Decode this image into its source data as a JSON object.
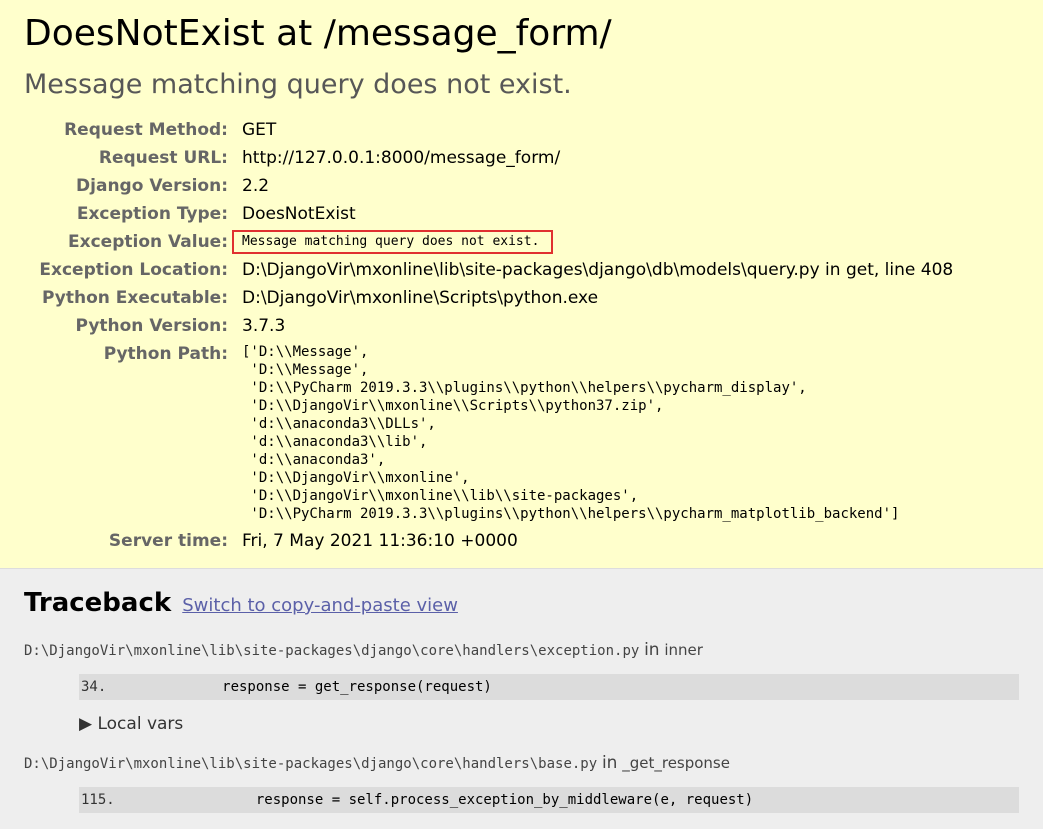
{
  "summary": {
    "title": "DoesNotExist at /message_form/",
    "exception_message": "Message matching query does not exist.",
    "meta": [
      {
        "label": "Request Method:",
        "value": "GET"
      },
      {
        "label": "Request URL:",
        "value": "http://127.0.0.1:8000/message_form/"
      },
      {
        "label": "Django Version:",
        "value": "2.2"
      },
      {
        "label": "Exception Type:",
        "value": "DoesNotExist"
      },
      {
        "label": "Exception Value:",
        "value": "Message matching query does not exist."
      },
      {
        "label": "Exception Location:",
        "value": "D:\\DjangoVir\\mxonline\\lib\\site-packages\\django\\db\\models\\query.py in get, line 408"
      },
      {
        "label": "Python Executable:",
        "value": "D:\\DjangoVir\\mxonline\\Scripts\\python.exe"
      },
      {
        "label": "Python Version:",
        "value": "3.7.3"
      },
      {
        "label": "Python Path:",
        "value": "['D:\\\\Message',\n 'D:\\\\Message',\n 'D:\\\\PyCharm 2019.3.3\\\\plugins\\\\python\\\\helpers\\\\pycharm_display',\n 'D:\\\\DjangoVir\\\\mxonline\\\\Scripts\\\\python37.zip',\n 'd:\\\\anaconda3\\\\DLLs',\n 'd:\\\\anaconda3\\\\lib',\n 'd:\\\\anaconda3',\n 'D:\\\\DjangoVir\\\\mxonline',\n 'D:\\\\DjangoVir\\\\mxonline\\\\lib\\\\site-packages',\n 'D:\\\\PyCharm 2019.3.3\\\\plugins\\\\python\\\\helpers\\\\pycharm_matplotlib_backend']"
      },
      {
        "label": "Server time:",
        "value": "Fri, 7 May 2021 11:36:10 +0000"
      }
    ]
  },
  "traceback": {
    "heading": "Traceback",
    "toggle_link": "Switch to copy-and-paste view",
    "frames": [
      {
        "file": "D:\\DjangoVir\\mxonline\\lib\\site-packages\\django\\core\\handlers\\exception.py",
        "in_word": "in",
        "function": "inner",
        "lineno": "34.",
        "code": "            response = get_response(request)",
        "local_vars_label": "▶ Local vars"
      },
      {
        "file": "D:\\DjangoVir\\mxonline\\lib\\site-packages\\django\\core\\handlers\\base.py",
        "in_word": "in",
        "function": "_get_response",
        "lineno": "115.",
        "code": "                response = self.process_exception_by_middleware(e, request)"
      }
    ]
  },
  "colors": {
    "summary_bg": "#ffffcc",
    "traceback_bg": "#eeeeee",
    "highlight_box": "#e03030",
    "link": "#5b60a8"
  }
}
